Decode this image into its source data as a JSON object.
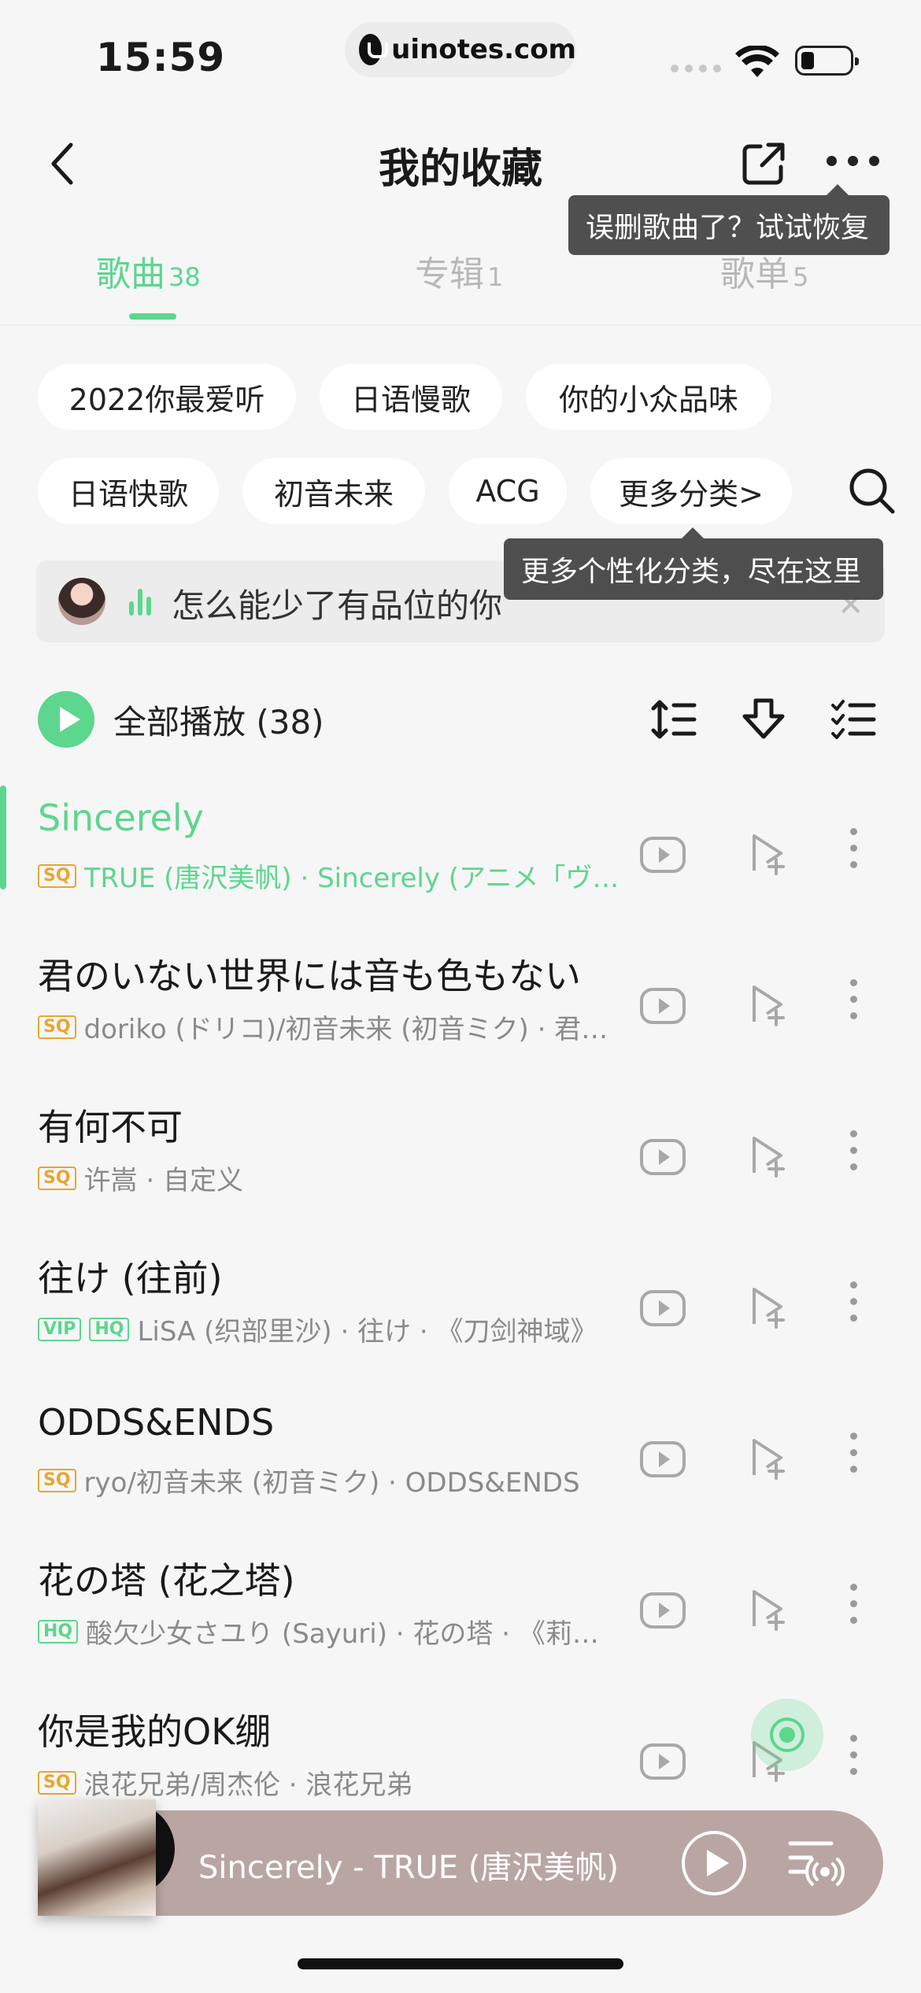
{
  "status": {
    "time": "15:59",
    "url": "uinotes.com"
  },
  "header": {
    "title": "我的收藏"
  },
  "tooltips": {
    "restore": "误删歌曲了？试试恢复",
    "categories": "更多个性化分类，尽在这里"
  },
  "tabs": [
    {
      "label": "歌曲",
      "count": "38"
    },
    {
      "label": "专辑",
      "count": "1"
    },
    {
      "label": "歌单",
      "count": "5"
    }
  ],
  "chips": [
    "2022你最爱听",
    "日语慢歌",
    "你的小众品味",
    "日语快歌",
    "初音未来",
    "ACG",
    "更多分类>"
  ],
  "banner": {
    "text": "怎么能少了有品位的你"
  },
  "play_all": {
    "label": "全部播放 (38)"
  },
  "songs": [
    {
      "title": "Sincerely",
      "badges": [
        "SQ"
      ],
      "meta": "TRUE (唐沢美帆) · Sincerely (アニメ「ヴァイオレット・エヴァーガーデン」OP)",
      "playing": true
    },
    {
      "title": "君のいない世界には音も色もない",
      "badges": [
        "SQ"
      ],
      "meta": "doriko (ドリコ)/初音未来 (初音ミク) · 君のいない世界には音も色もない"
    },
    {
      "title": "有何不可",
      "badges": [
        "SQ"
      ],
      "meta": "许嵩 · 自定义"
    },
    {
      "title": "往け (往前)",
      "badges": [
        "VIP",
        "HQ"
      ],
      "meta": "LiSA (织部里沙) · 往け · 《刀剑神域》"
    },
    {
      "title": "ODDS&ENDS",
      "badges": [
        "SQ"
      ],
      "meta": "ryo/初音未来 (初音ミク) · ODDS&ENDS"
    },
    {
      "title": "花の塔 (花之塔)",
      "badges": [
        "HQ"
      ],
      "meta": "酸欠少女さユり (Sayuri) · 花の塔 · 《莉可丽丝》"
    },
    {
      "title": "你是我的OK绷",
      "badges": [
        "SQ"
      ],
      "meta": "浪花兄弟/周杰伦 · 浪花兄弟"
    }
  ],
  "player": {
    "now_playing": "Sincerely - TRUE (唐沢美帆)"
  },
  "colors": {
    "accent": "#5dd68e",
    "sq": "#e6a731",
    "player_bg": "#b9a6a2"
  }
}
